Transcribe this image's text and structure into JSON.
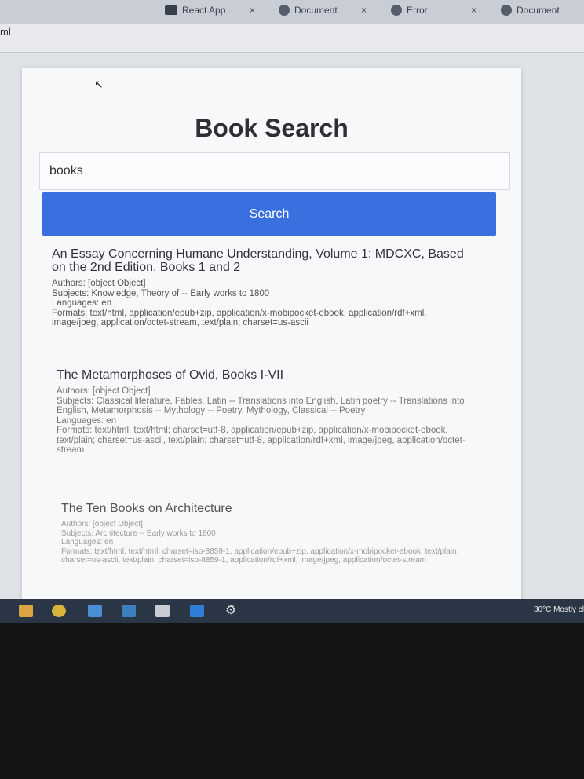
{
  "browser": {
    "tabs": [
      {
        "label": "React App"
      },
      {
        "label": "Document"
      },
      {
        "label": "Error"
      },
      {
        "label": "Document"
      }
    ],
    "close_glyph": "×",
    "address_fragment": "ml"
  },
  "page": {
    "title": "Book Search",
    "search": {
      "value": "books",
      "button_label": "Search"
    },
    "results": [
      {
        "title": "An Essay Concerning Humane Understanding, Volume 1: MDCXC, Based on the 2nd Edition, Books 1 and 2",
        "authors": "Authors: [object Object]",
        "subjects": "Subjects: Knowledge, Theory of -- Early works to 1800",
        "languages": "Languages: en",
        "formats": "Formats: text/html, application/epub+zip, application/x-mobipocket-ebook, application/rdf+xml, image/jpeg, application/octet-stream, text/plain; charset=us-ascii"
      },
      {
        "title": "The Metamorphoses of Ovid, Books I-VII",
        "authors": "Authors: [object Object]",
        "subjects": "Subjects: Classical literature, Fables, Latin -- Translations into English, Latin poetry -- Translations into English, Metamorphosis -- Mythology -- Poetry, Mythology, Classical -- Poetry",
        "languages": "Languages: en",
        "formats": "Formats: text/html, text/html; charset=utf-8, application/epub+zip, application/x-mobipocket-ebook, text/plain; charset=us-ascii, text/plain; charset=utf-8, application/rdf+xml, image/jpeg, application/octet-stream"
      },
      {
        "title": "The Ten Books on Architecture",
        "authors": "Authors: [object Object]",
        "subjects": "Subjects: Architecture -- Early works to 1800",
        "languages": "Languages: en",
        "formats": "Formats: text/html, text/html; charset=iso-8859-1, application/epub+zip, application/x-mobipocket-ebook, text/plain; charset=us-ascii, text/plain; charset=iso-8859-1, application/rdf+xml, image/jpeg, application/octet-stream"
      }
    ]
  },
  "taskbar": {
    "weather": "30°C  Mostly cl"
  },
  "colors": {
    "accent": "#3a6fe0",
    "taskbar": "#2a3645"
  }
}
